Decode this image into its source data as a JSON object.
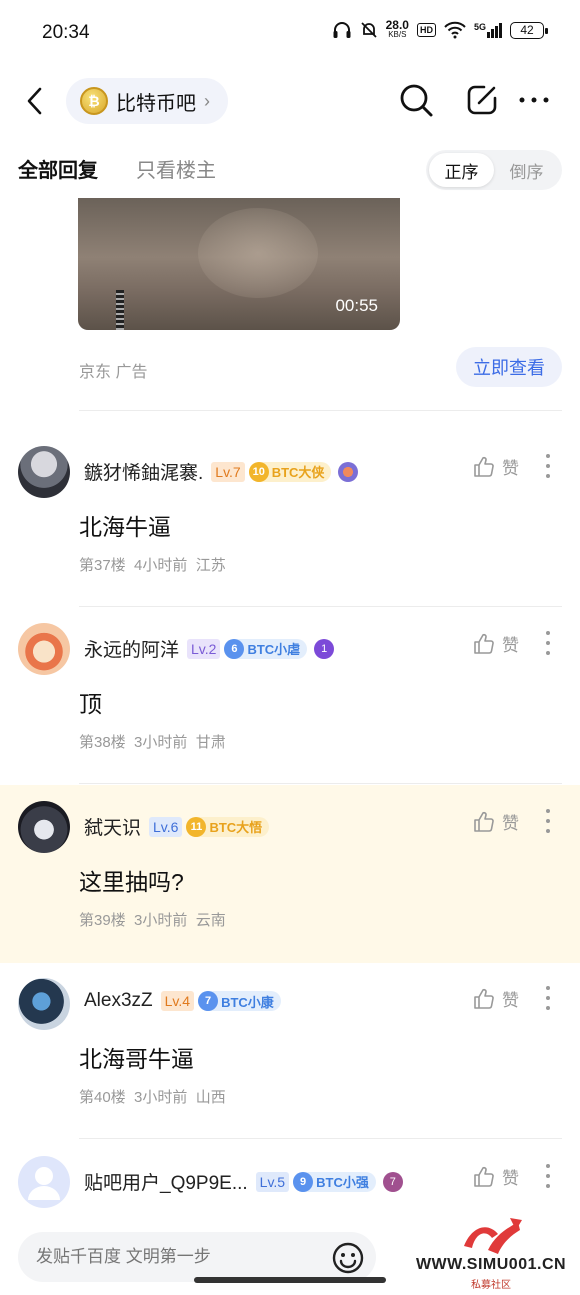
{
  "status_bar": {
    "time": "20:34",
    "speed_value": "28.0",
    "speed_unit": "KB/S",
    "hd": "HD",
    "signal": "5G",
    "battery": "42"
  },
  "header": {
    "forum_name": "比特币吧",
    "coin_symbol": "₿"
  },
  "tabs": {
    "all_replies": "全部回复",
    "op_only": "只看楼主",
    "order_asc": "正序",
    "order_desc": "倒序"
  },
  "ad": {
    "duration": "00:55",
    "source": "京东  广告",
    "cta": "立即查看"
  },
  "comments": [
    {
      "username": "鏃犲悕鈾浘褰.",
      "level": "Lv.7",
      "badge_num": "10",
      "badge_label": "BTC大侠",
      "content": "北海牛逼",
      "floor": "第37楼",
      "time": "4小时前",
      "location": "江苏",
      "like": "赞"
    },
    {
      "username": "永远的阿洋",
      "level": "Lv.2",
      "badge_num": "6",
      "badge_label": "BTC小虐",
      "medal_num": "1",
      "content": "顶",
      "floor": "第38楼",
      "time": "3小时前",
      "location": "甘肃",
      "like": "赞"
    },
    {
      "username": "弑天识",
      "level": "Lv.6",
      "badge_num": "11",
      "badge_label": "BTC大悟",
      "content": "这里抽吗?",
      "floor": "第39楼",
      "time": "3小时前",
      "location": "云南",
      "like": "赞"
    },
    {
      "username": "Alex3zZ",
      "level": "Lv.4",
      "badge_num": "7",
      "badge_label": "BTC小康",
      "content": "北海哥牛逼",
      "floor": "第40楼",
      "time": "3小时前",
      "location": "山西",
      "like": "赞"
    },
    {
      "username": "贴吧用户_Q9P9E...",
      "level": "Lv.5",
      "badge_num": "9",
      "badge_label": "BTC小强",
      "medal_num": "7",
      "like": "赞"
    }
  ],
  "bottom_bar": {
    "reply_placeholder": "发贴千百度 文明第一步"
  },
  "watermark": {
    "site": "WWW.SIMU001.CN",
    "sub": "私募社区"
  },
  "colors": {
    "accent_blue": "#3c6ce6",
    "highlight_row": "#fff9e8",
    "badge_gold": "#f2b52b",
    "badge_blue": "#5a92ee"
  }
}
